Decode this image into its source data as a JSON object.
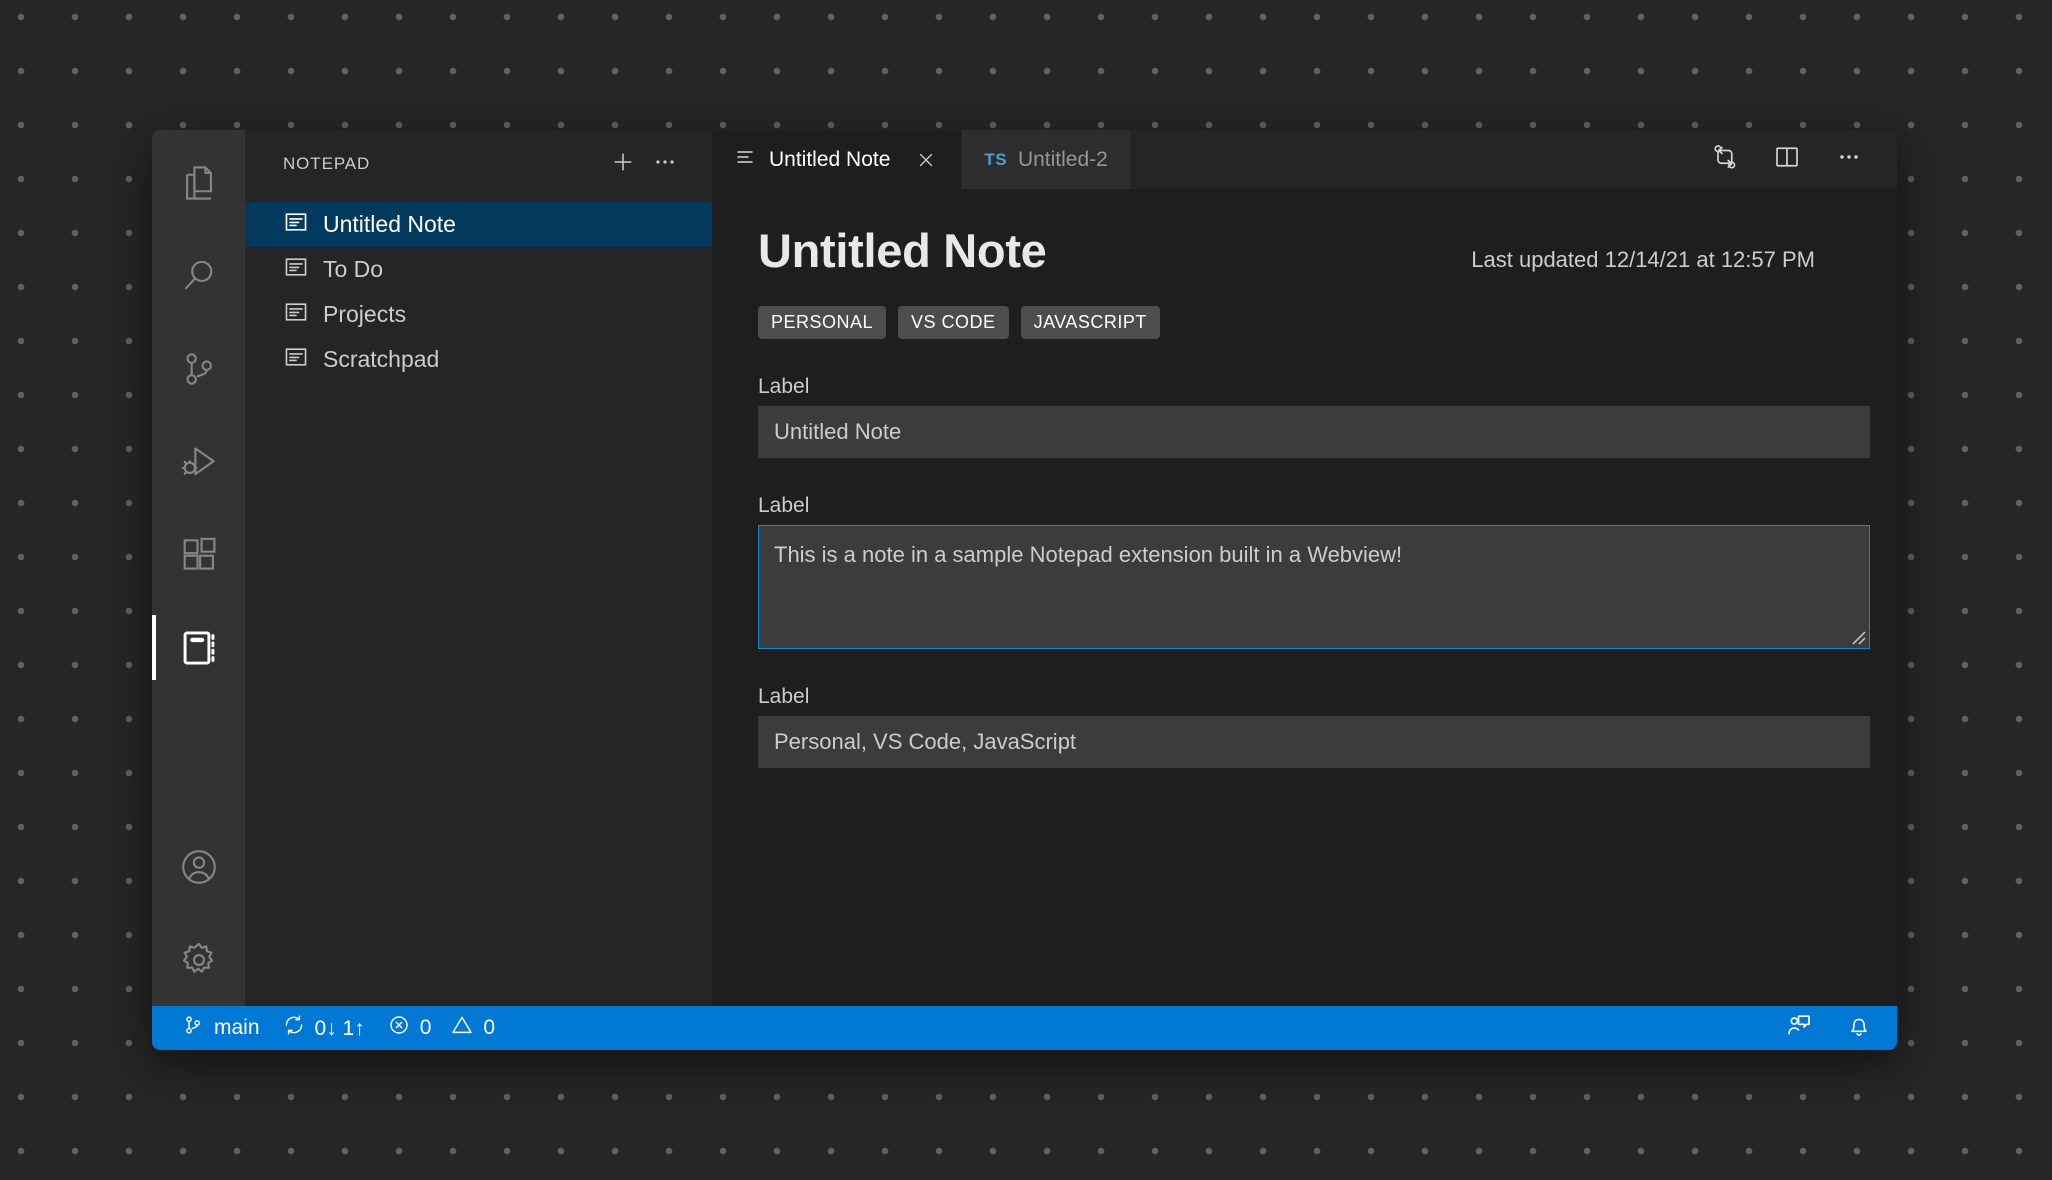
{
  "activity_bar": {
    "items": [
      {
        "name": "explorer",
        "icon": "files-icon",
        "active": false
      },
      {
        "name": "search",
        "icon": "search-icon",
        "active": false
      },
      {
        "name": "source-control",
        "icon": "source-control-icon",
        "active": false
      },
      {
        "name": "run-and-debug",
        "icon": "run-and-debug-icon",
        "active": false
      },
      {
        "name": "extensions",
        "icon": "extensions-icon",
        "active": false
      },
      {
        "name": "notepad",
        "icon": "notepad-icon",
        "active": true
      }
    ],
    "bottom_items": [
      {
        "name": "accounts",
        "icon": "account-icon"
      },
      {
        "name": "manage",
        "icon": "gear-icon"
      }
    ]
  },
  "sidebar": {
    "title": "NOTEPAD",
    "actions": [
      {
        "name": "new-note",
        "icon": "plus-icon"
      },
      {
        "name": "more-actions",
        "icon": "ellipsis-icon"
      }
    ],
    "notes": [
      {
        "label": "Untitled Note",
        "icon": "note-icon",
        "selected": true
      },
      {
        "label": "To Do",
        "icon": "note-icon",
        "selected": false
      },
      {
        "label": "Projects",
        "icon": "note-icon",
        "selected": false
      },
      {
        "label": "Scratchpad",
        "icon": "note-icon",
        "selected": false
      }
    ]
  },
  "tabs": [
    {
      "label": "Untitled Note",
      "icon": "note-list-icon",
      "active": true,
      "close_icon": "close-icon"
    },
    {
      "label": "Untitled-2",
      "badge": "TS",
      "active": false
    }
  ],
  "editor_actions": [
    {
      "name": "compare-changes",
      "icon": "compare-changes-icon"
    },
    {
      "name": "split-editor",
      "icon": "split-editor-icon"
    },
    {
      "name": "more-actions",
      "icon": "ellipsis-icon"
    }
  ],
  "note": {
    "title": "Untitled Note",
    "last_updated": "Last updated 12/14/21 at 12:57 PM",
    "tags": [
      "PERSONAL",
      "VS CODE",
      "JAVASCRIPT"
    ],
    "fields": [
      {
        "label": "Label",
        "type": "text",
        "value": "Untitled Note",
        "focused": false
      },
      {
        "label": "Label",
        "type": "textarea",
        "value": "This is a note in a sample Notepad extension built in a Webview!",
        "focused": true
      },
      {
        "label": "Label",
        "type": "text",
        "value": "Personal, VS Code, JavaScript",
        "focused": false
      }
    ]
  },
  "status_bar": {
    "branch": "main",
    "sync": "0↓ 1↑",
    "errors": "0",
    "warnings": "0",
    "right_items": [
      {
        "name": "feedback",
        "icon": "feedback-icon"
      },
      {
        "name": "notifications",
        "icon": "bell-icon"
      }
    ]
  },
  "colors": {
    "accent": "#0078d4",
    "selection": "#04395e",
    "focus_border": "#0d8bd9",
    "editor_bg": "#1e1e1e",
    "sidebar_bg": "#252526",
    "activity_bg": "#333333",
    "input_bg": "#3c3c3c",
    "tag_bg": "#4d4d4d",
    "ts_badge": "#4a9fd4"
  }
}
